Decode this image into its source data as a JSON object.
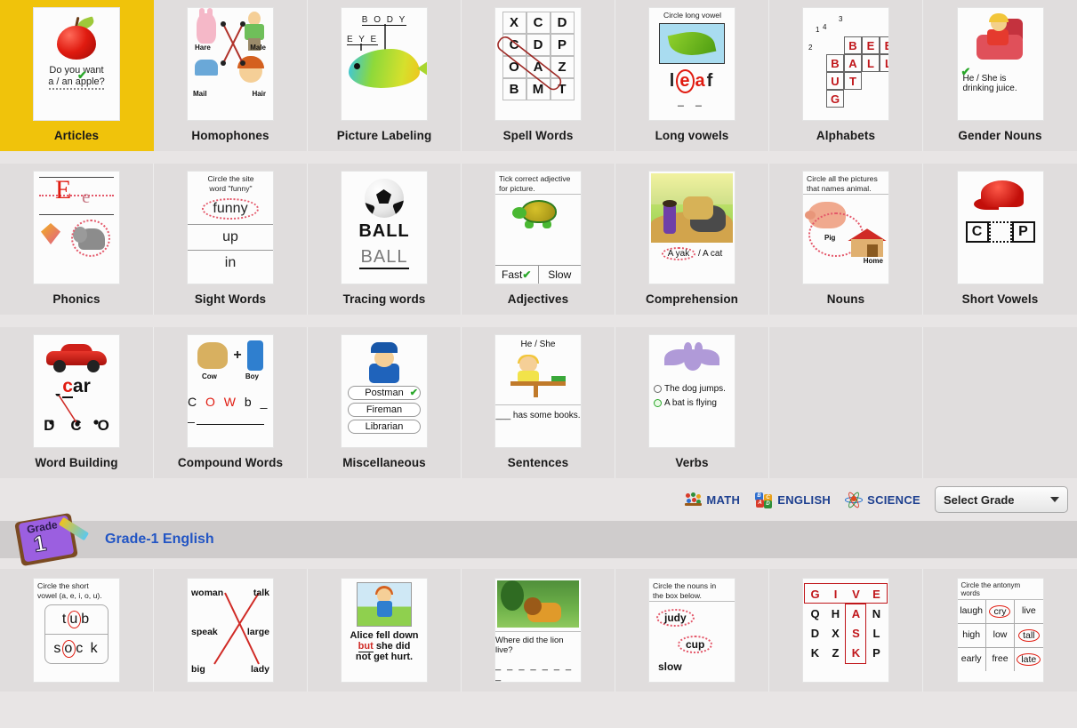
{
  "worksheet_rows": [
    {
      "cells": [
        {
          "title": "Articles",
          "selected": true,
          "art": "articles",
          "text": {
            "line1": "Do you want",
            "line2": "a / an  apple?",
            "check": "✔"
          }
        },
        {
          "title": "Homophones",
          "selected": false,
          "art": "homophones",
          "text": {
            "w1": "Hare",
            "w2": "Male",
            "w3": "Mail",
            "w4": "Hair"
          }
        },
        {
          "title": "Picture Labeling",
          "selected": false,
          "art": "picture-labeling",
          "text": {
            "top": "B O D Y",
            "left": "E Y E"
          }
        },
        {
          "title": "Spell Words",
          "selected": false,
          "art": "spell-words",
          "letters": [
            "X",
            "C",
            "D",
            "C",
            "D",
            "P",
            "O",
            "A",
            "Z",
            "B",
            "M",
            "T"
          ]
        },
        {
          "title": "Long vowels",
          "selected": false,
          "art": "long-vowels",
          "text": {
            "hint": "Circle long vowel",
            "word_l": "l",
            "word_e": "e",
            "word_a": "a",
            "word_f": "f"
          }
        },
        {
          "title": "Alphabets",
          "selected": false,
          "art": "alphabets",
          "crossword": {
            "n1": "1",
            "n2": "2",
            "n3": "3",
            "n4": "4",
            "row1": [
              "B",
              "E",
              "E"
            ],
            "row2": [
              "B",
              "A",
              "L",
              "L"
            ],
            "row3": [
              "U",
              "T"
            ],
            "row4": [
              "G"
            ]
          }
        },
        {
          "title": "Gender Nouns",
          "selected": false,
          "art": "gender-nouns",
          "text": {
            "line1": "He / She is",
            "line2": "drinking juice.",
            "check": "✔"
          }
        }
      ]
    },
    {
      "cells": [
        {
          "title": "Phonics",
          "selected": false,
          "art": "phonics",
          "text": {
            "big": "E",
            "small": "e"
          }
        },
        {
          "title": "Sight Words",
          "selected": false,
          "art": "sight-words",
          "text": {
            "hint1": "Circle the site",
            "hint2": "word \"funny\"",
            "w1": "funny",
            "w2": "up",
            "w3": "in"
          }
        },
        {
          "title": "Tracing words",
          "selected": false,
          "art": "tracing-words",
          "text": {
            "solid": "BALL",
            "trace": "BALL"
          }
        },
        {
          "title": "Adjectives",
          "selected": false,
          "art": "adjectives",
          "text": {
            "hint1": "Tick correct adjective",
            "hint2": "for picture.",
            "opt1": "Fast",
            "opt2": "Slow",
            "check": "✔"
          }
        },
        {
          "title": "Comprehension",
          "selected": false,
          "art": "comprehension",
          "text": {
            "ans1": "A yak",
            "sep": "/",
            "ans2": "A cat"
          }
        },
        {
          "title": "Nouns",
          "selected": false,
          "art": "nouns",
          "text": {
            "hint1": "Circle all the pictures",
            "hint2": "that names animal.",
            "l1": "Pig",
            "l2": "Home"
          }
        },
        {
          "title": "Short Vowels",
          "selected": false,
          "art": "short-vowels",
          "text": {
            "b1": "C",
            "b2": "",
            "b3": "P"
          }
        }
      ]
    },
    {
      "cells": [
        {
          "title": "Word Building",
          "selected": false,
          "art": "word-building",
          "text": {
            "word_c": "c",
            "word_ar": "ar",
            "o1": "D",
            "o2": "C",
            "o3": "O"
          }
        },
        {
          "title": "Compound Words",
          "selected": false,
          "art": "compound-words",
          "text": {
            "l1": "Cow",
            "l2": "Boy",
            "plus": "+",
            "line": "C O W b _ _"
          }
        },
        {
          "title": "Miscellaneous",
          "selected": false,
          "art": "miscellaneous",
          "text": {
            "opt1": "Postman",
            "opt2": "Fireman",
            "opt3": "Librarian",
            "check": "✔"
          }
        },
        {
          "title": "Sentences",
          "selected": false,
          "art": "sentences",
          "text": {
            "top": "He / She",
            "bottom": "___ has some books."
          }
        },
        {
          "title": "Verbs",
          "selected": false,
          "art": "verbs",
          "text": {
            "opt1": "The dog jumps.",
            "opt2": "A bat is flying"
          }
        },
        {
          "title": "",
          "selected": false,
          "art": "empty"
        },
        {
          "title": "",
          "selected": false,
          "art": "empty"
        }
      ]
    }
  ],
  "nav": {
    "subjects": [
      {
        "label": "MATH",
        "icon": "abacus-icon"
      },
      {
        "label": "ENGLISH",
        "icon": "alphabet-blocks-icon"
      },
      {
        "label": "SCIENCE",
        "icon": "atom-icon"
      }
    ],
    "grade_select": {
      "value": "Select Grade",
      "caret": "▼"
    }
  },
  "banner": {
    "badge_top": "Grade",
    "badge_num": "1",
    "title": "Grade-1 English"
  },
  "bottom_row": {
    "cells": [
      {
        "title": "",
        "art": "short-vowel-circle",
        "text": {
          "hint1": "Circle the short",
          "hint2": "vowel (a, e, i, o, u).",
          "w1a": "t",
          "w1b": "u",
          "w1c": "b",
          "w2a": "s",
          "w2b": "o",
          "w2c": "c k"
        }
      },
      {
        "title": "",
        "art": "match-words",
        "text": {
          "l1": "woman",
          "r1": "talk",
          "l2": "speak",
          "r2": "large",
          "l3": "big",
          "r3": "lady"
        }
      },
      {
        "title": "",
        "art": "alice-sentence",
        "text": {
          "line1": "Alice fell down",
          "answer": "but",
          "line2": "she did",
          "line3": "not get hurt."
        }
      },
      {
        "title": "",
        "art": "lion-question",
        "text": {
          "q": "Where did the lion live?",
          "blank": "_ _ _ _ _ _ _ _"
        }
      },
      {
        "title": "",
        "art": "circle-nouns",
        "text": {
          "hint1": "Circle the nouns in",
          "hint2": "the box below.",
          "w1": "judy",
          "w2": "cup",
          "w3": "slow"
        }
      },
      {
        "title": "",
        "art": "word-search",
        "text": {
          "word": [
            "G",
            "I",
            "V",
            "E"
          ],
          "rows": [
            [
              "Q",
              "H",
              "A",
              "N"
            ],
            [
              "D",
              "X",
              "S",
              "L"
            ],
            [
              "K",
              "Z",
              "K",
              "P"
            ]
          ]
        }
      },
      {
        "title": "",
        "art": "antonyms",
        "text": {
          "hint": "Circle the antonym words",
          "rows": [
            [
              "laugh",
              "cry",
              "live"
            ],
            [
              "high",
              "low",
              "tall"
            ],
            [
              "early",
              "free",
              "late"
            ]
          ],
          "circled": [
            1,
            2,
            2
          ]
        }
      }
    ]
  }
}
